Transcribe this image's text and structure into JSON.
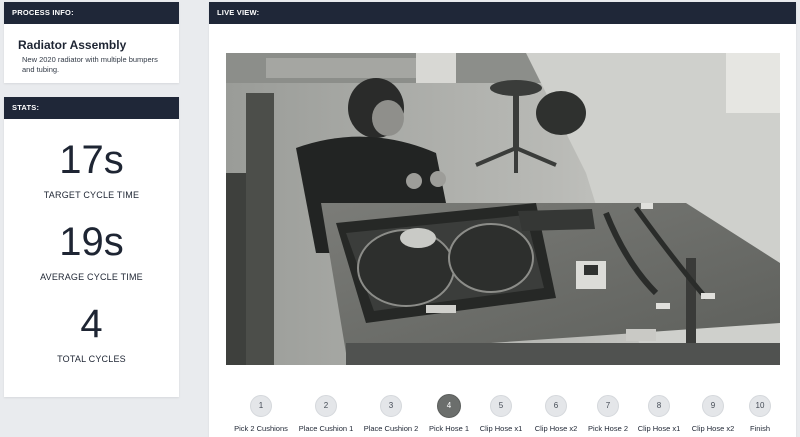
{
  "process_info": {
    "header": "PROCESS INFO:",
    "title": "Radiator Assembly",
    "description": "New 2020 radiator with multiple bumpers and tubing."
  },
  "stats": {
    "header": "STATS:",
    "target_cycle_time": {
      "value": "17s",
      "label": "TARGET CYCLE TIME"
    },
    "average_cycle_time": {
      "value": "19s",
      "label": "AVERAGE CYCLE TIME"
    },
    "total_cycles": {
      "value": "4",
      "label": "TOTAL CYCLES"
    }
  },
  "live_view": {
    "header": "LIVE VIEW:",
    "steps": [
      {
        "number": "1",
        "label": "Pick 2 Cushions",
        "active": false
      },
      {
        "number": "2",
        "label": "Place Cushion 1",
        "active": false
      },
      {
        "number": "3",
        "label": "Place Cushion 2",
        "active": false
      },
      {
        "number": "4",
        "label": "Pick Hose 1",
        "active": true
      },
      {
        "number": "5",
        "label": "Clip Hose x1",
        "active": false
      },
      {
        "number": "6",
        "label": "Clip Hose x2",
        "active": false
      },
      {
        "number": "7",
        "label": "Pick Hose 2",
        "active": false
      },
      {
        "number": "8",
        "label": "Clip Hose x1",
        "active": false
      },
      {
        "number": "9",
        "label": "Clip Hose x2",
        "active": false
      },
      {
        "number": "10",
        "label": "Finish",
        "active": false
      }
    ]
  },
  "colors": {
    "header_bg": "#1f2738",
    "active_step": "#6b6e6c",
    "inactive_step": "#e4e6e9"
  }
}
